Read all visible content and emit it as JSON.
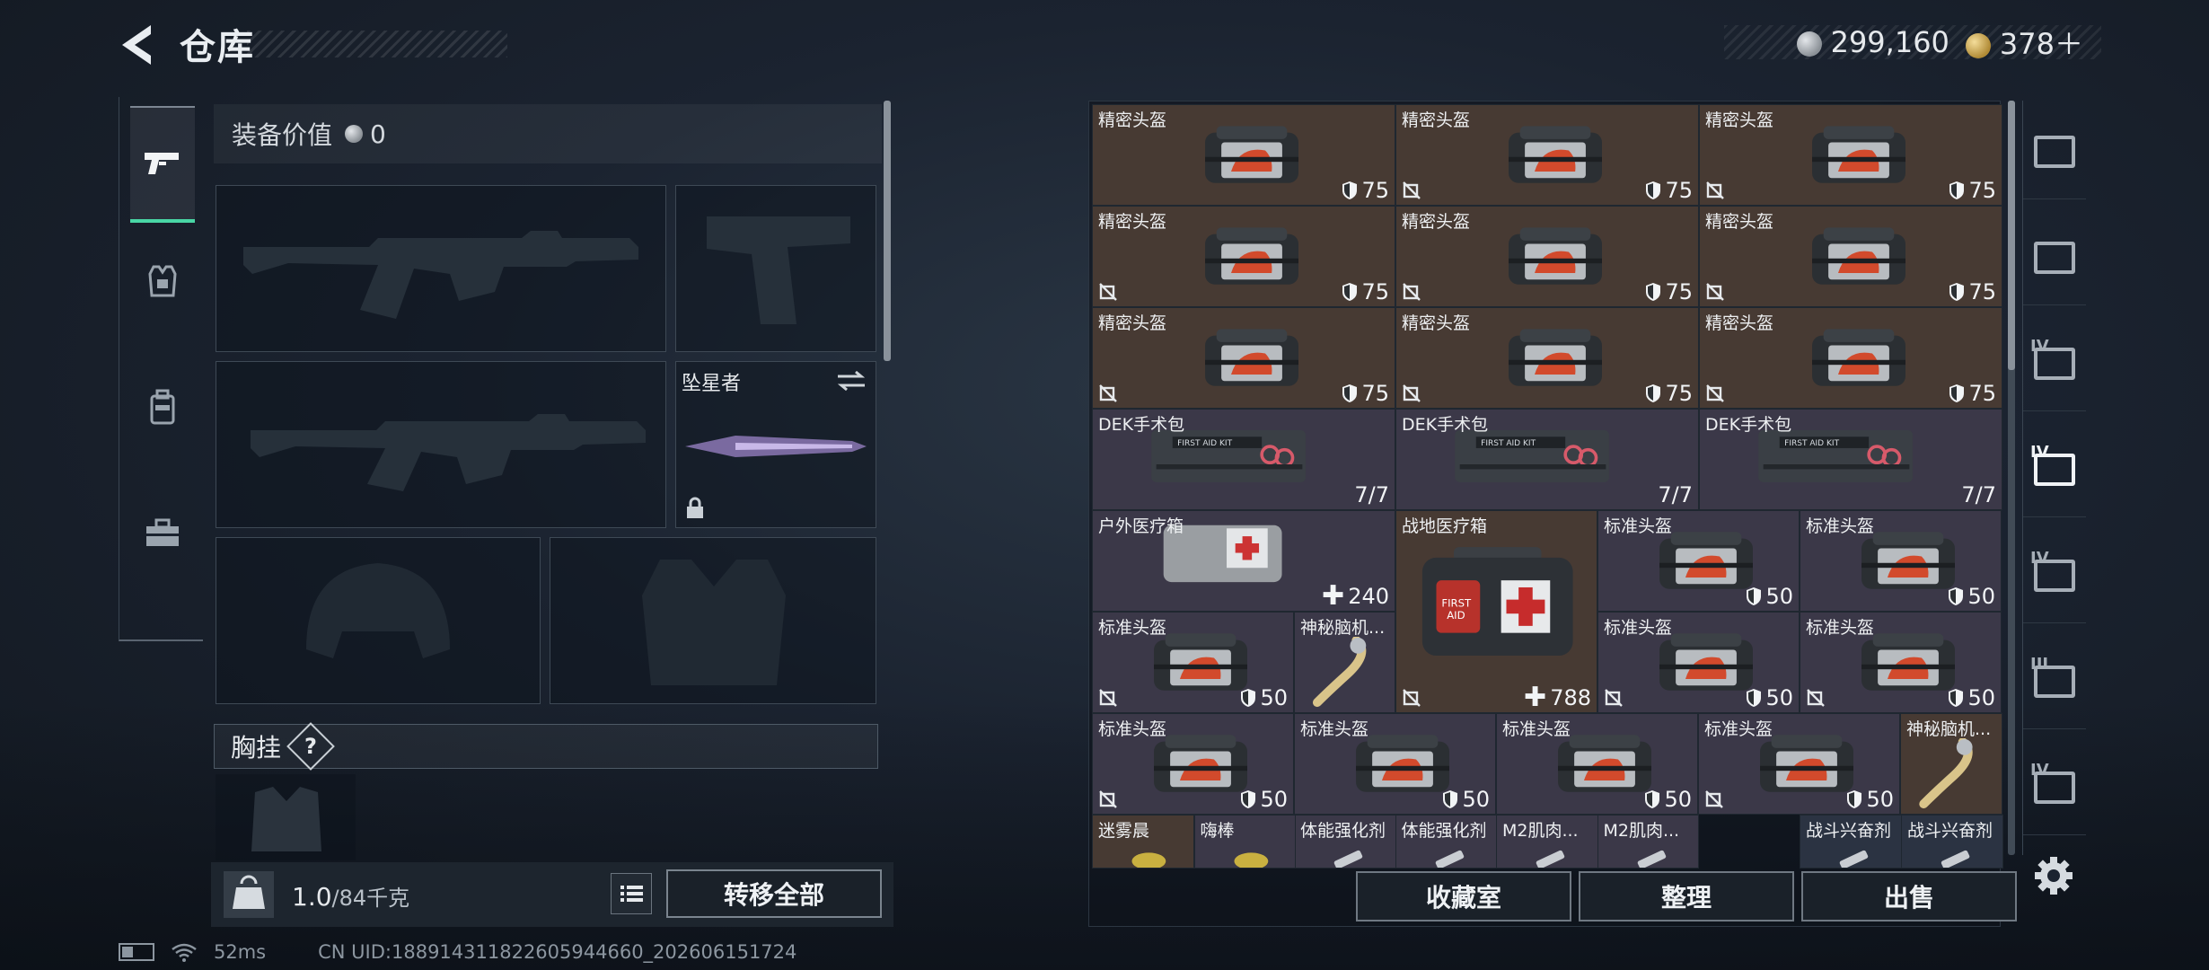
{
  "header": {
    "title": "仓库"
  },
  "currency": {
    "silver": "299,160",
    "gold": "378＋"
  },
  "equipment": {
    "value_label": "装备价值",
    "value": "0",
    "knife_slot_label": "坠星者",
    "chest_label": "胸挂",
    "chest_help": "?"
  },
  "bottom_left": {
    "weight": "1.0",
    "weight_capacity": "/84千克",
    "transfer_all": "转移全部"
  },
  "status": {
    "ping": "52ms",
    "uid": "CN UID:188914311822605944660_202606151724"
  },
  "warehouse": {
    "cells": [
      {
        "name": "精密头盔",
        "value": "75",
        "kind": "helmet",
        "bg": "brown",
        "locked": false
      },
      {
        "name": "精密头盔",
        "value": "75",
        "kind": "helmet",
        "bg": "brown",
        "locked": true
      },
      {
        "name": "精密头盔",
        "value": "75",
        "kind": "helmet",
        "bg": "brown",
        "locked": true
      },
      {
        "name": "精密头盔",
        "value": "75",
        "kind": "helmet",
        "bg": "brown",
        "locked": true
      },
      {
        "name": "精密头盔",
        "value": "75",
        "kind": "helmet",
        "bg": "brown",
        "locked": true
      },
      {
        "name": "精密头盔",
        "value": "75",
        "kind": "helmet",
        "bg": "brown",
        "locked": true
      },
      {
        "name": "精密头盔",
        "value": "75",
        "kind": "helmet",
        "bg": "brown",
        "locked": true
      },
      {
        "name": "精密头盔",
        "value": "75",
        "kind": "helmet",
        "bg": "brown",
        "locked": true
      },
      {
        "name": "精密头盔",
        "value": "75",
        "kind": "helmet",
        "bg": "brown",
        "locked": true
      },
      {
        "name": "DEK手术包",
        "value": "7/7",
        "kind": "kit",
        "bg": "purple",
        "locked": false
      },
      {
        "name": "DEK手术包",
        "value": "7/7",
        "kind": "kit",
        "bg": "purple",
        "locked": false
      },
      {
        "name": "DEK手术包",
        "value": "7/7",
        "kind": "kit",
        "bg": "purple",
        "locked": false
      },
      {
        "name": "户外医疗箱",
        "value": "240",
        "kind": "medpouch",
        "bg": "purple",
        "locked": false
      },
      {
        "name": "战地医疗箱",
        "value": "788",
        "kind": "firstaid",
        "bg": "brown",
        "locked": true
      },
      {
        "name": "标准头盔",
        "value": "50",
        "kind": "helmet",
        "bg": "purple",
        "locked": false
      },
      {
        "name": "标准头盔",
        "value": "50",
        "kind": "helmet",
        "bg": "purple",
        "locked": false
      },
      {
        "name": "标准头盔",
        "value": "50",
        "kind": "helmet",
        "bg": "purple",
        "locked": true
      },
      {
        "name": "神秘脑机...",
        "value": "",
        "kind": "brace",
        "bg": "purple",
        "locked": false
      },
      {
        "name": "标准头盔",
        "value": "50",
        "kind": "helmet",
        "bg": "purple",
        "locked": true
      },
      {
        "name": "标准头盔",
        "value": "50",
        "kind": "helmet",
        "bg": "purple",
        "locked": true
      },
      {
        "name": "标准头盔",
        "value": "50",
        "kind": "helmet",
        "bg": "purple",
        "locked": true
      },
      {
        "name": "标准头盔",
        "value": "50",
        "kind": "helmet",
        "bg": "purple",
        "locked": false
      },
      {
        "name": "标准头盔",
        "value": "50",
        "kind": "helmet",
        "bg": "purple",
        "locked": false
      },
      {
        "name": "标准头盔",
        "value": "50",
        "kind": "helmet",
        "bg": "purple",
        "locked": true
      },
      {
        "name": "神秘脑机...",
        "value": "",
        "kind": "brace",
        "bg": "brown",
        "locked": false
      },
      {
        "name": "迷雾晨",
        "value": "",
        "kind": "misc",
        "bg": "brown",
        "locked": false
      },
      {
        "name": "嗨棒",
        "value": "",
        "kind": "misc",
        "bg": "purple",
        "locked": false
      },
      {
        "name": "体能强化剂",
        "value": "",
        "kind": "syringe",
        "bg": "purple",
        "locked": false
      },
      {
        "name": "体能强化剂",
        "value": "",
        "kind": "syringe",
        "bg": "purple",
        "locked": false
      },
      {
        "name": "M2肌肉...",
        "value": "",
        "kind": "syringe",
        "bg": "purple",
        "locked": false
      },
      {
        "name": "M2肌肉...",
        "value": "",
        "kind": "syringe",
        "bg": "purple",
        "locked": false
      },
      {
        "name": "战斗兴奋剂",
        "value": "",
        "kind": "syringe",
        "bg": "blue",
        "locked": false
      },
      {
        "name": "战斗兴奋剂",
        "value": "",
        "kind": "syringe",
        "bg": "blue",
        "locked": false
      }
    ]
  },
  "bottom_right": {
    "vault": "收藏室",
    "sort": "整理",
    "sell": "出售"
  },
  "right_rail": [
    {
      "label": "",
      "active": false
    },
    {
      "label": "",
      "active": false
    },
    {
      "label": "IV",
      "active": false
    },
    {
      "label": "IV",
      "active": true
    },
    {
      "label": "IV",
      "active": false
    },
    {
      "label": "III",
      "active": false
    },
    {
      "label": "IV",
      "active": false
    }
  ],
  "colors": {
    "accent": "#49d6a5",
    "cell_brown": "#473a33",
    "cell_purple": "#3b3848",
    "helmet_red": "#d24a2c"
  }
}
